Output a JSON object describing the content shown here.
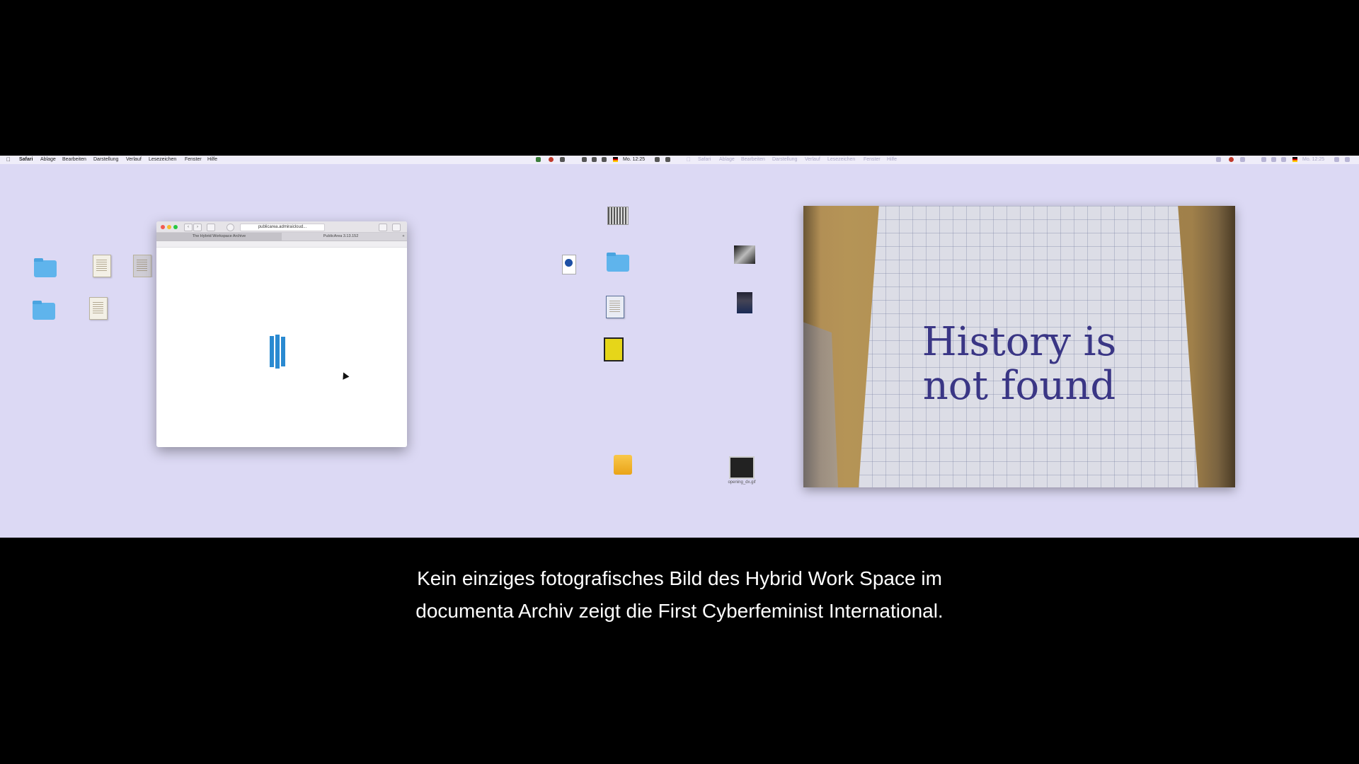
{
  "menubar": {
    "app": "Safari",
    "items": [
      "Ablage",
      "Bearbeiten",
      "Darstellung",
      "Verlauf",
      "Lesezeichen",
      "Fenster",
      "Hilfe"
    ],
    "clock": "Mo. 12:25",
    "dim_app": "Safari",
    "dim_items": [
      "Ablage",
      "Bearbeiten",
      "Darstellung",
      "Verlauf",
      "Lesezeichen",
      "Fenster",
      "Hilfe"
    ],
    "dim_clock": "Mo. 12:25"
  },
  "safari": {
    "url": "publicarea.admiraicloud...",
    "tabs": [
      "The Hybrid Workspace Archive",
      "PublicArea 3.13.152"
    ],
    "loader_color": "#2a8ad1"
  },
  "desktop": {
    "opening_file": "opening_dx.gif"
  },
  "photo": {
    "line1": "History is",
    "line2": "not found"
  },
  "subtitle": {
    "line1": "Kein einziges fotografisches Bild des Hybrid Work Space im",
    "line2": "documenta Archiv zeigt die First Cyberfeminist International."
  }
}
